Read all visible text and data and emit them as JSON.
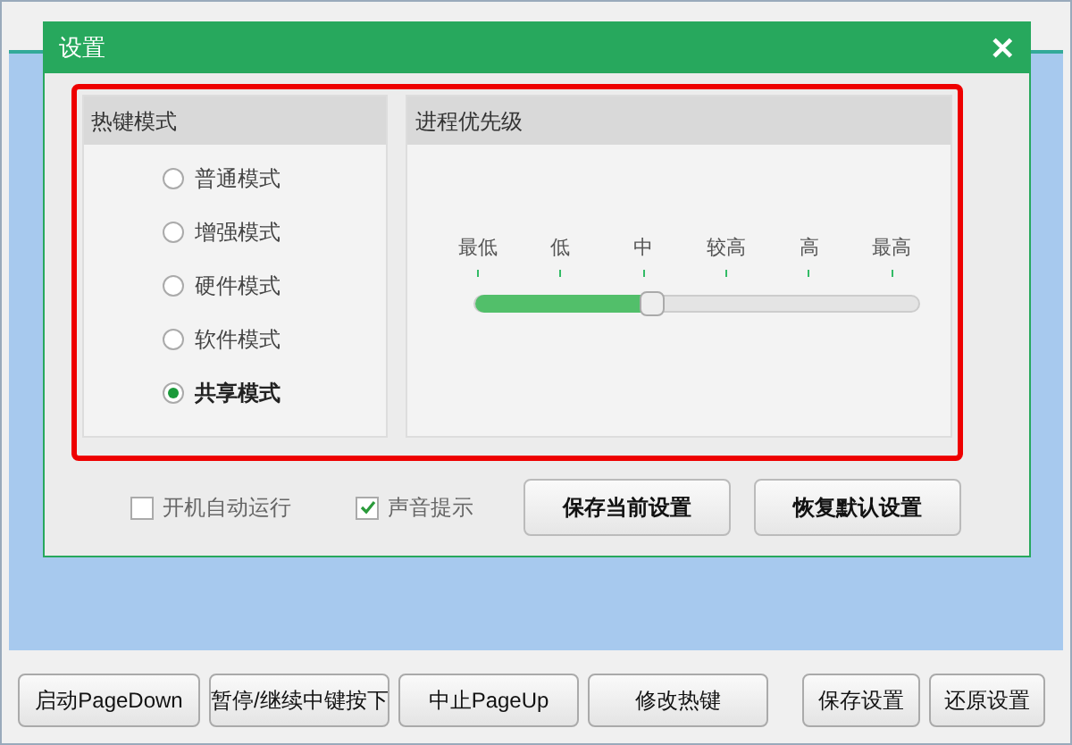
{
  "dialog": {
    "title": "设置",
    "close": "✕",
    "hotkey_mode": {
      "title": "热键模式",
      "options": [
        {
          "label": "普通模式",
          "selected": false
        },
        {
          "label": "增强模式",
          "selected": false
        },
        {
          "label": "硬件模式",
          "selected": false
        },
        {
          "label": "软件模式",
          "selected": false
        },
        {
          "label": "共享模式",
          "selected": true
        }
      ]
    },
    "priority": {
      "title": "进程优先级",
      "ticks": [
        "最低",
        "低",
        "中",
        "较高",
        "高",
        "最高"
      ],
      "level": 0.4
    },
    "checkboxes": [
      {
        "label": "开机自动运行",
        "checked": false
      },
      {
        "label": "声音提示",
        "checked": true
      }
    ],
    "buttons": [
      "保存当前设置",
      "恢复默认设置"
    ]
  },
  "toolbar": [
    "启动PageDown",
    "暂停/继续中键按下",
    "中止PageUp",
    "修改热键",
    "保存设置",
    "还原设置"
  ]
}
